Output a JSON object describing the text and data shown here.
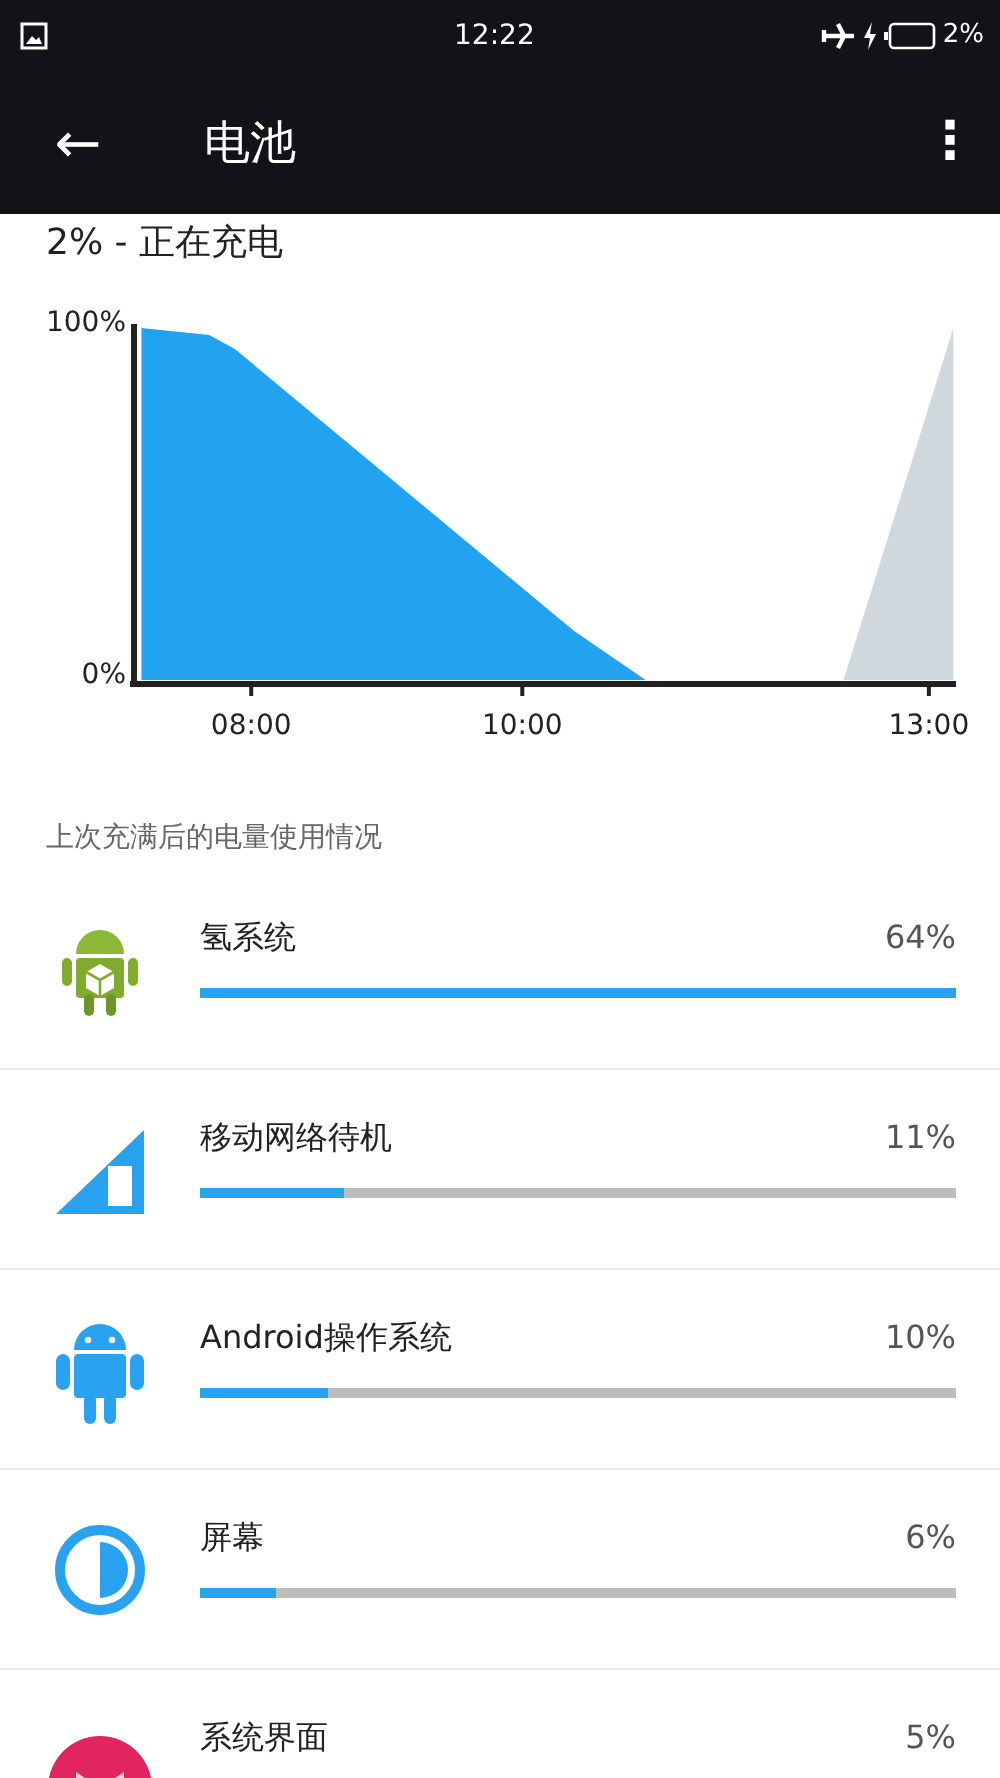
{
  "status_bar": {
    "time": "12:22",
    "battery_text": "2%"
  },
  "toolbar": {
    "back": "←",
    "title": "电池",
    "menu": "⋮"
  },
  "battery_state": "2% - 正在充电",
  "history": {
    "chart_data": {
      "type": "area",
      "x": [
        7.19,
        7.69,
        7.88,
        10.38,
        10.91,
        12.37,
        13.18
      ],
      "series": [
        {
          "color": "#22a3f0",
          "values": [
            100,
            98,
            94,
            14,
            0,
            null,
            null
          ]
        },
        {
          "color": "#cfd8dc",
          "values": [
            null,
            null,
            null,
            null,
            null,
            0,
            100
          ]
        }
      ],
      "xlim": [
        7.15,
        13.2
      ],
      "ylim": [
        0,
        100
      ],
      "xticks": [
        {
          "value": 8,
          "label": "08:00"
        },
        {
          "value": 10,
          "label": "10:00"
        },
        {
          "value": 13,
          "label": "13:00"
        }
      ],
      "yticks": [
        {
          "value": 0,
          "label": "0%"
        },
        {
          "value": 100,
          "label": "100%"
        }
      ]
    }
  },
  "usage_heading": "上次充满后的电量使用情况",
  "items": [
    {
      "kind": "app",
      "name": "氢系统",
      "percent": "64%",
      "level": 1
    },
    {
      "kind": "signal",
      "name": "移动网络待机",
      "percent": "11%",
      "level": 0.19
    },
    {
      "kind": "robot",
      "name": "Android操作系统",
      "percent": "10%",
      "level": 0.17
    },
    {
      "kind": "screen",
      "name": "屏幕",
      "percent": "6%",
      "level": 0.1
    },
    {
      "kind": "ui",
      "name": "系统界面",
      "percent": "5%"
    }
  ]
}
